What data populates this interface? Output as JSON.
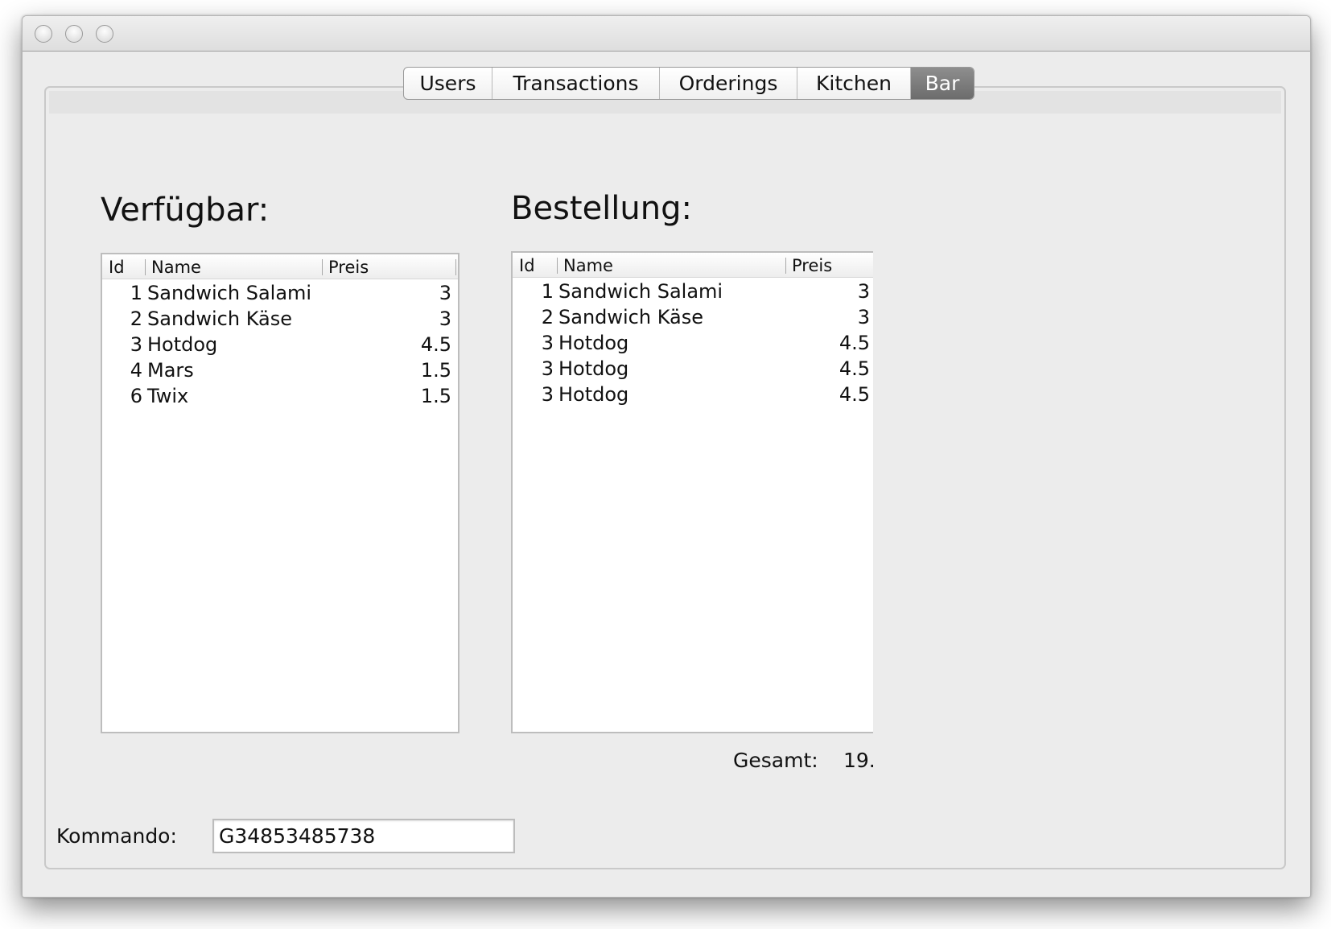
{
  "window": {
    "controls": [
      "close-button",
      "minimize-button",
      "zoom-button"
    ]
  },
  "tabs": [
    {
      "label": "Users"
    },
    {
      "label": "Transactions"
    },
    {
      "label": "Orderings"
    },
    {
      "label": "Kitchen"
    },
    {
      "label": "Bar",
      "active": true
    }
  ],
  "available": {
    "title": "Verfügbar:",
    "columns": {
      "id": "Id",
      "name": "Name",
      "price": "Preis"
    },
    "rows": [
      {
        "id": "1",
        "name": "Sandwich Salami",
        "price": "3"
      },
      {
        "id": "2",
        "name": "Sandwich Käse",
        "price": "3"
      },
      {
        "id": "3",
        "name": "Hotdog",
        "price": "4.5"
      },
      {
        "id": "4",
        "name": "Mars",
        "price": "1.5"
      },
      {
        "id": "6",
        "name": "Twix",
        "price": "1.5"
      }
    ]
  },
  "order": {
    "title": "Bestellung:",
    "columns": {
      "id": "Id",
      "name": "Name",
      "price": "Preis"
    },
    "rows": [
      {
        "id": "1",
        "name": "Sandwich Salami",
        "price": "3"
      },
      {
        "id": "2",
        "name": "Sandwich Käse",
        "price": "3"
      },
      {
        "id": "3",
        "name": "Hotdog",
        "price": "4.5"
      },
      {
        "id": "3",
        "name": "Hotdog",
        "price": "4.5"
      },
      {
        "id": "3",
        "name": "Hotdog",
        "price": "4.5"
      }
    ],
    "total_label": "Gesamt:",
    "total_value": "19."
  },
  "command": {
    "label": "Kommando:",
    "value": "G34853485738"
  },
  "colors": {
    "window_bg": "#ececec",
    "active_tab": "#7a7a7a",
    "table_bg": "#ffffff"
  }
}
